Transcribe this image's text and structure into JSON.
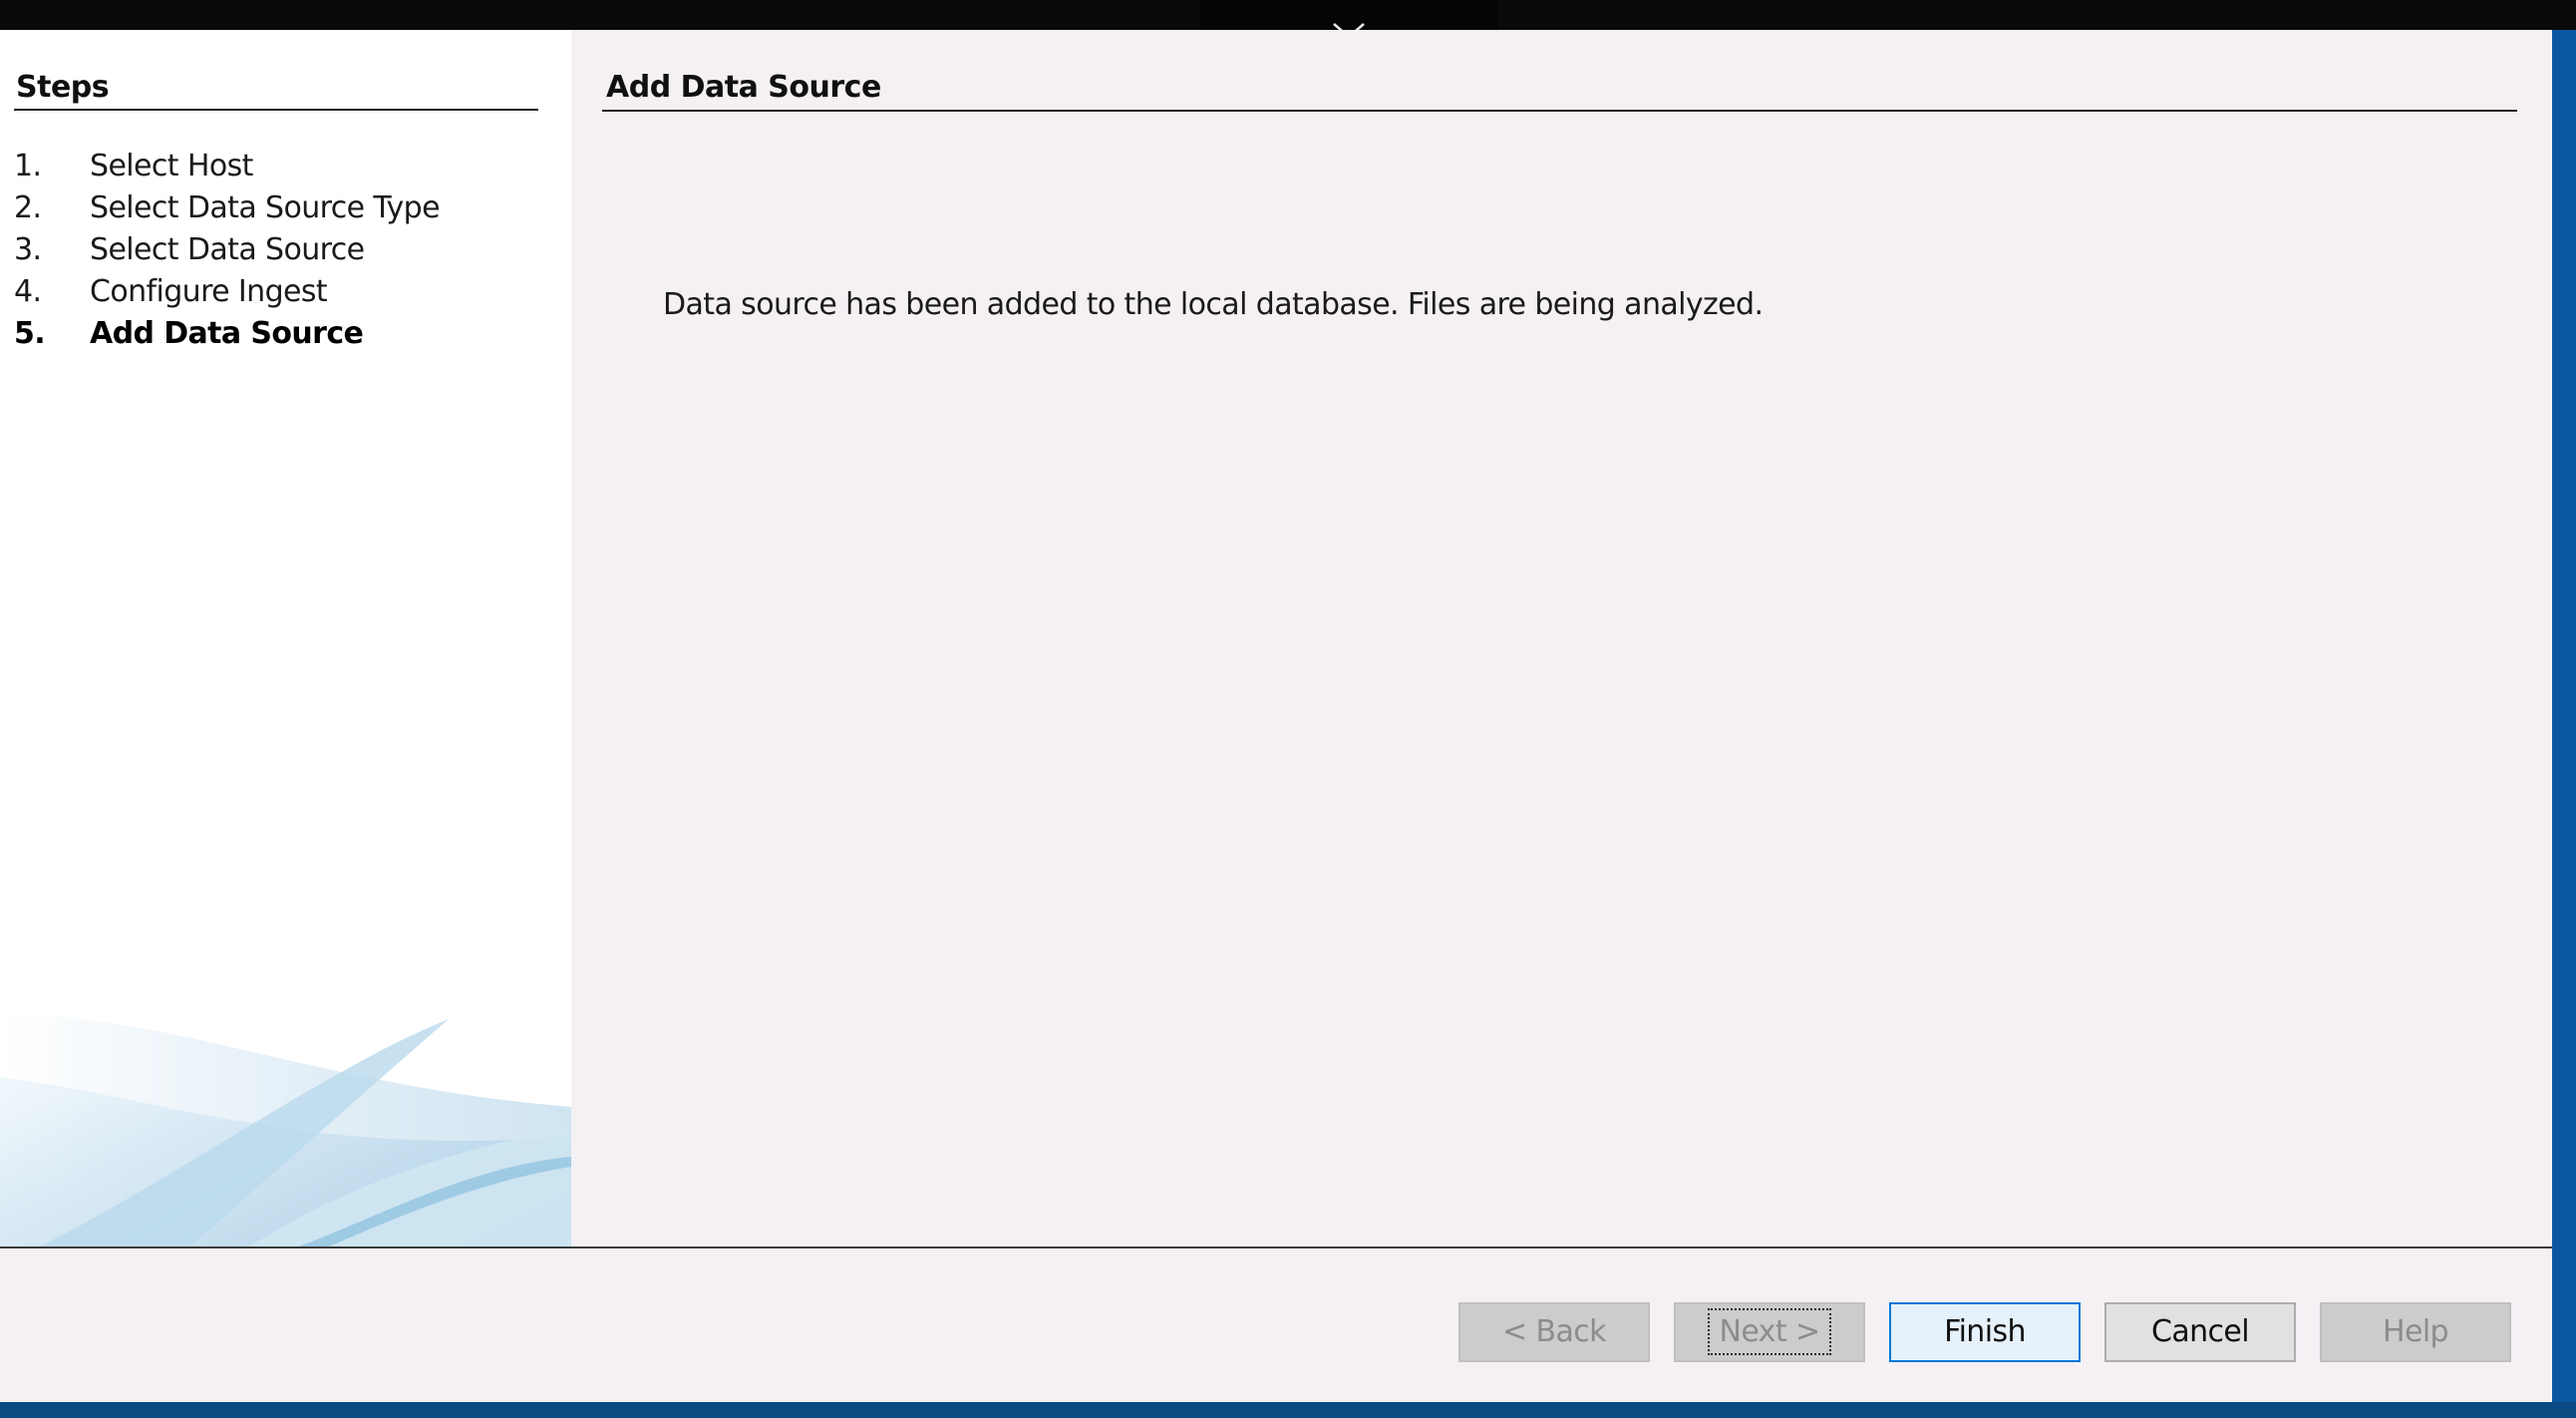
{
  "wizard": {
    "steps_title": "Steps",
    "steps": [
      {
        "num": "1.",
        "label": "Select Host"
      },
      {
        "num": "2.",
        "label": "Select Data Source Type"
      },
      {
        "num": "3.",
        "label": "Select Data Source"
      },
      {
        "num": "4.",
        "label": "Configure Ingest"
      },
      {
        "num": "5.",
        "label": "Add Data Source"
      }
    ],
    "active_step": 5,
    "content_title": "Add Data Source",
    "status_message": "Data source has been added to the local database. Files are being analyzed."
  },
  "buttons": {
    "back": "< Back",
    "next": "Next >",
    "finish": "Finish",
    "cancel": "Cancel",
    "help": "Help"
  },
  "icons": {
    "dropdown": "chevron-down-icon",
    "decoration": "wave-graphic"
  },
  "colors": {
    "dialog_bg": "#f4f0f4",
    "default_button_border": "#0078d7",
    "desktop_bg": "#0b4f8c"
  }
}
